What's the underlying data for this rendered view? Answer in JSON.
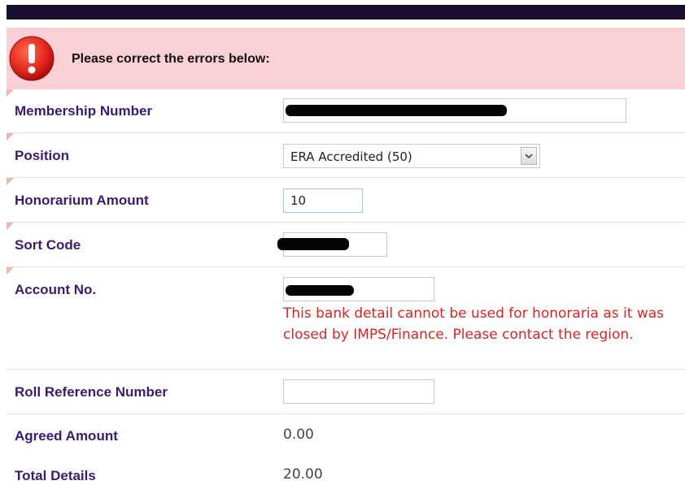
{
  "banner": {
    "message": "Please correct the errors below:",
    "icon": "exclamation-icon",
    "bg_color": "#f9d0d6",
    "icon_color": "#e0241b"
  },
  "form": {
    "membership_number": {
      "label": "Membership Number",
      "value": ""
    },
    "position": {
      "label": "Position",
      "selected": "ERA Accredited (50)"
    },
    "honorarium_amount": {
      "label": "Honorarium Amount",
      "value": "10"
    },
    "sort_code": {
      "label": "Sort Code",
      "value": ""
    },
    "account_no": {
      "label": "Account No.",
      "value": "",
      "error": "This bank detail cannot be used for honoraria as it was closed by IMPS/Finance. Please contact the region."
    },
    "roll_reference_number": {
      "label": "Roll Reference Number",
      "value": ""
    },
    "agreed_amount": {
      "label": "Agreed Amount",
      "value": "0.00"
    },
    "total_details": {
      "label": "Total Details",
      "value": "20.00"
    }
  },
  "colors": {
    "label": "#3c1a6e",
    "error_text": "#d42424",
    "topbar": "#1a0f2e"
  }
}
